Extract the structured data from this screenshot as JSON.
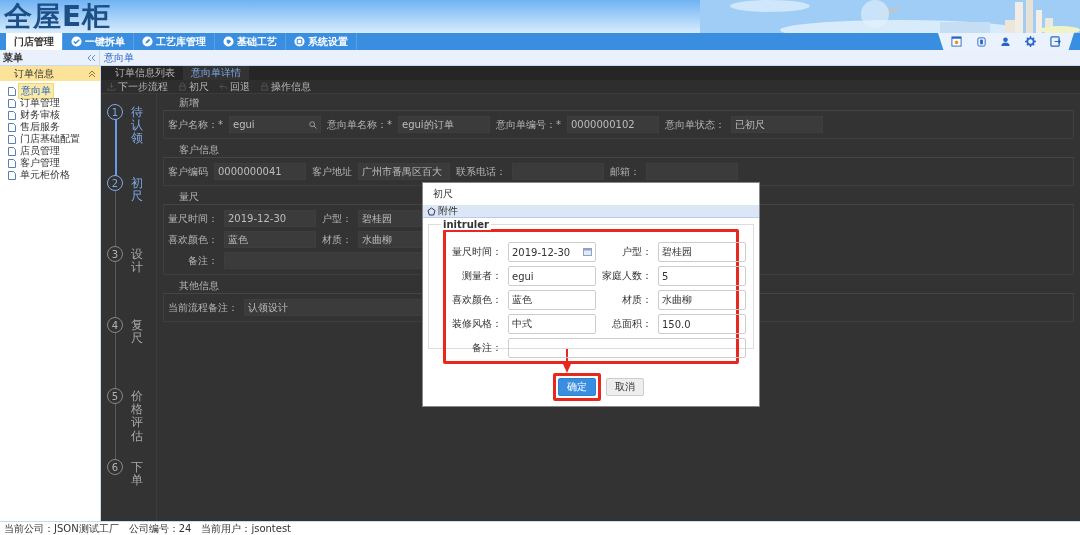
{
  "header": {
    "logo": "全屋E柜"
  },
  "nav_tabs": [
    {
      "label": "门店管理",
      "selected": true
    },
    {
      "label": "一键拆单",
      "selected": false,
      "kind": "check"
    },
    {
      "label": "工艺库管理",
      "selected": false,
      "kind": "pencil"
    },
    {
      "label": "基础工艺",
      "selected": false,
      "kind": "tag"
    },
    {
      "label": "系统设置",
      "selected": false,
      "kind": "ring"
    }
  ],
  "sidebar": {
    "title": "菜单",
    "group": {
      "label": "订单信息",
      "expanded": true
    },
    "items": [
      {
        "label": "意向单",
        "selected": true
      },
      {
        "label": "订单管理",
        "selected": false
      },
      {
        "label": "财务审核",
        "selected": false
      },
      {
        "label": "售后服务",
        "selected": false
      },
      {
        "label": "门店基础配置",
        "selected": false
      },
      {
        "label": "店员管理",
        "selected": false
      },
      {
        "label": "客户管理",
        "selected": false
      },
      {
        "label": "单元柜价格",
        "selected": false
      }
    ]
  },
  "breadcrumb": "意向单",
  "page_tabs": [
    {
      "label": "订单信息列表",
      "selected": false
    },
    {
      "label": "意向单详情",
      "selected": true
    }
  ],
  "toolbar": [
    {
      "label": "下一步流程",
      "kind": "download"
    },
    {
      "label": "初尺",
      "kind": "lock"
    },
    {
      "label": "回退",
      "kind": "back"
    },
    {
      "label": "操作信息",
      "kind": "lock"
    }
  ],
  "steps": [
    {
      "number": "1",
      "label": "待认领",
      "done": true
    },
    {
      "number": "2",
      "label": "初尺",
      "done": true
    },
    {
      "number": "3",
      "label": "设计",
      "done": false
    },
    {
      "number": "4",
      "label": "复尺",
      "done": false
    },
    {
      "number": "5",
      "label": "价格评估",
      "done": false
    },
    {
      "number": "6",
      "label": "下单",
      "done": false
    }
  ],
  "sections": [
    {
      "title": "新增",
      "rows": [
        [
          {
            "label": "客户名称：*",
            "value": "egui",
            "kind": "search"
          },
          {
            "label": "意向单名称：*",
            "value": "egui的订单",
            "kind": "text"
          },
          {
            "label": "意向单编号：*",
            "value": "0000000102",
            "kind": "text"
          },
          {
            "label": "意向单状态：",
            "value": "已初尺",
            "kind": "text"
          }
        ]
      ]
    },
    {
      "title": "客户信息",
      "rows": [
        [
          {
            "label": "客户编码",
            "value": "0000000041",
            "kind": "text"
          },
          {
            "label": "客户地址",
            "value": "广州市番禺区百大",
            "kind": "text"
          },
          {
            "label": "联系电话：",
            "kind": "text"
          },
          {
            "label": "邮箱：",
            "kind": "text"
          }
        ]
      ]
    },
    {
      "title": "量尺",
      "rows": [
        [
          {
            "label": "量尺时间：",
            "value": "2019-12-30",
            "kind": "text"
          },
          {
            "label": "户型：",
            "value": "碧桂园",
            "kind": "text"
          }
        ],
        [
          {
            "label": "喜欢颜色：",
            "value": "蓝色",
            "kind": "text"
          },
          {
            "label": "材质：",
            "value": "水曲柳",
            "kind": "text"
          }
        ],
        [
          {
            "label": "备注：",
            "kind": "wide"
          }
        ]
      ]
    },
    {
      "title": "其他信息",
      "rows": [
        [
          {
            "label": "当前流程备注：",
            "value": "认领设计",
            "kind": "wide"
          }
        ]
      ]
    }
  ],
  "dialog": {
    "title": "初尺",
    "attachment": "附件",
    "legend": "initruler",
    "fields": [
      {
        "label": "量尺时间：",
        "value": "2019-12-30",
        "kind": "date"
      },
      {
        "label": "户型：",
        "value": "碧桂园",
        "kind": "text"
      },
      {
        "label": "测量者：",
        "value": "egui",
        "kind": "text"
      },
      {
        "label": "家庭人数：",
        "value": "5",
        "kind": "text"
      },
      {
        "label": "喜欢颜色：",
        "value": "蓝色",
        "kind": "text"
      },
      {
        "label": "材质：",
        "value": "水曲柳",
        "kind": "text"
      },
      {
        "label": "装修风格：",
        "value": "中式",
        "kind": "text"
      },
      {
        "label": "总面积：",
        "value": "150.0",
        "kind": "text"
      },
      {
        "label": "备注：",
        "kind": "textarea"
      }
    ],
    "buttons": [
      {
        "label": "确定",
        "kind": "primary"
      },
      {
        "label": "取消",
        "kind": "default"
      }
    ]
  },
  "status_bar": [
    "当前公司：JSON测试工厂",
    "公司编号：24",
    "当前用户：jsontest"
  ]
}
